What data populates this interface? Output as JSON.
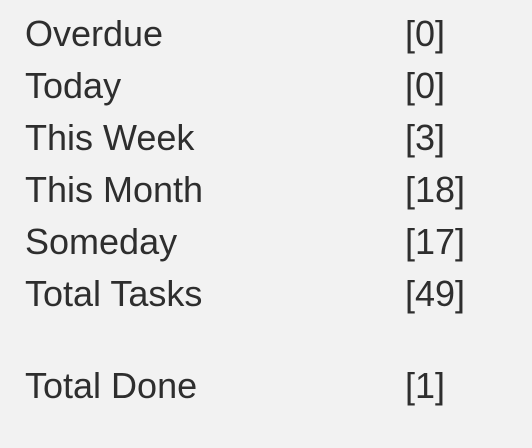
{
  "task_summary": {
    "rows": [
      {
        "label": "Overdue",
        "count": "[0]"
      },
      {
        "label": "Today",
        "count": "[0]"
      },
      {
        "label": "This Week",
        "count": "[3]"
      },
      {
        "label": "This Month",
        "count": "[18]"
      },
      {
        "label": "Someday",
        "count": "[17]"
      },
      {
        "label": "Total Tasks",
        "count": "[49]"
      }
    ],
    "done": {
      "label": "Total Done",
      "count": "[1]"
    }
  },
  "colors": {
    "background": "#f2f2f2",
    "text": "#2e2e2e"
  }
}
